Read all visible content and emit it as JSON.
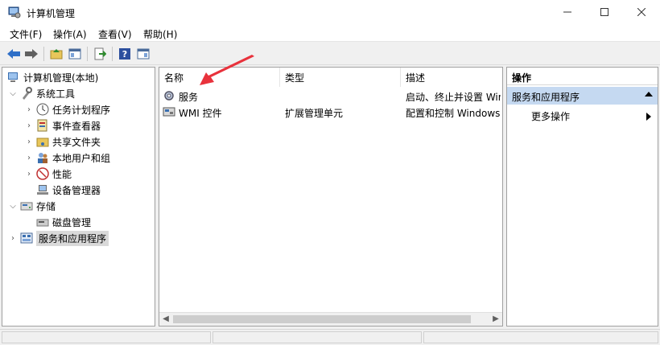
{
  "window": {
    "title": "计算机管理",
    "minimize_icon": "minimize-icon",
    "maximize_icon": "maximize-icon",
    "close_icon": "close-icon"
  },
  "menu": {
    "items": [
      "文件(F)",
      "操作(A)",
      "查看(V)",
      "帮助(H)"
    ]
  },
  "toolbar": {
    "icons": [
      "back-arrow-icon",
      "forward-arrow-icon",
      "up-folder-icon",
      "show-hide-tree-icon",
      "export-list-icon",
      "help-icon",
      "show-hide-action-pane-icon"
    ]
  },
  "tree": {
    "root": "计算机管理(本地)",
    "system_tools": "系统工具",
    "task_scheduler": "任务计划程序",
    "event_viewer": "事件查看器",
    "shared_folders": "共享文件夹",
    "local_users": "本地用户和组",
    "performance": "性能",
    "device_manager": "设备管理器",
    "storage": "存储",
    "disk_management": "磁盘管理",
    "services_apps": "服务和应用程序"
  },
  "list": {
    "columns": [
      "名称",
      "类型",
      "描述"
    ],
    "rows": [
      {
        "name": "服务",
        "type": "",
        "desc": "启动、终止并设置 Windows 服务。"
      },
      {
        "name": "WMI 控件",
        "type": "扩展管理单元",
        "desc": "配置和控制 Windows Management Instrumentation"
      }
    ]
  },
  "actions": {
    "header": "操作",
    "group": "服务和应用程序",
    "more": "更多操作"
  },
  "colors": {
    "selection_bg": "#c5d9f1",
    "arrow_red": "#e8323c"
  }
}
